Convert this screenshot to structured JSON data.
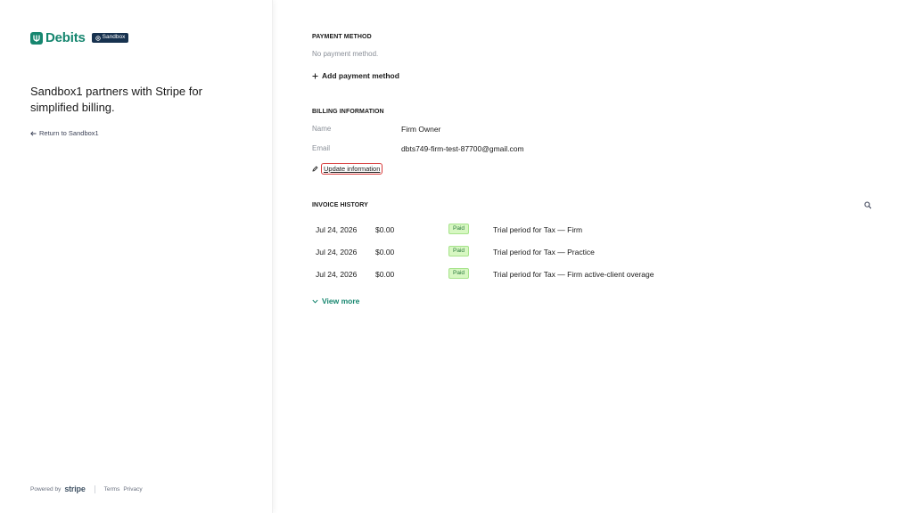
{
  "brand": {
    "name": "Debits",
    "badge": "Sandbox"
  },
  "tagline": "Sandbox1 partners with Stripe for simplified billing.",
  "return_link": "Return to Sandbox1",
  "footer": {
    "powered_by": "Powered by",
    "stripe": "stripe",
    "terms": "Terms",
    "privacy": "Privacy"
  },
  "payment_method": {
    "title": "PAYMENT METHOD",
    "empty_text": "No payment method.",
    "add_label": "Add payment method"
  },
  "billing": {
    "title": "BILLING INFORMATION",
    "name_label": "Name",
    "name_value": "Firm Owner",
    "email_label": "Email",
    "email_value": "dbts749-firm-test-87700@gmail.com",
    "update_label": "Update information"
  },
  "invoices": {
    "title": "INVOICE HISTORY",
    "rows": [
      {
        "date": "Jul 24, 2026",
        "amount": "$0.00",
        "status": "Paid",
        "description": "Trial period for Tax — Firm"
      },
      {
        "date": "Jul 24, 2026",
        "amount": "$0.00",
        "status": "Paid",
        "description": "Trial period for Tax — Practice"
      },
      {
        "date": "Jul 24, 2026",
        "amount": "$0.00",
        "status": "Paid",
        "description": "Trial period for Tax — Firm active-client overage"
      }
    ],
    "view_more": "View more"
  },
  "colors": {
    "brand": "#16866f",
    "badge_bg": "#17324f",
    "paid_bg": "#d7f7c2",
    "paid_text": "#2c7a3f",
    "highlight": "#d83a3a"
  }
}
